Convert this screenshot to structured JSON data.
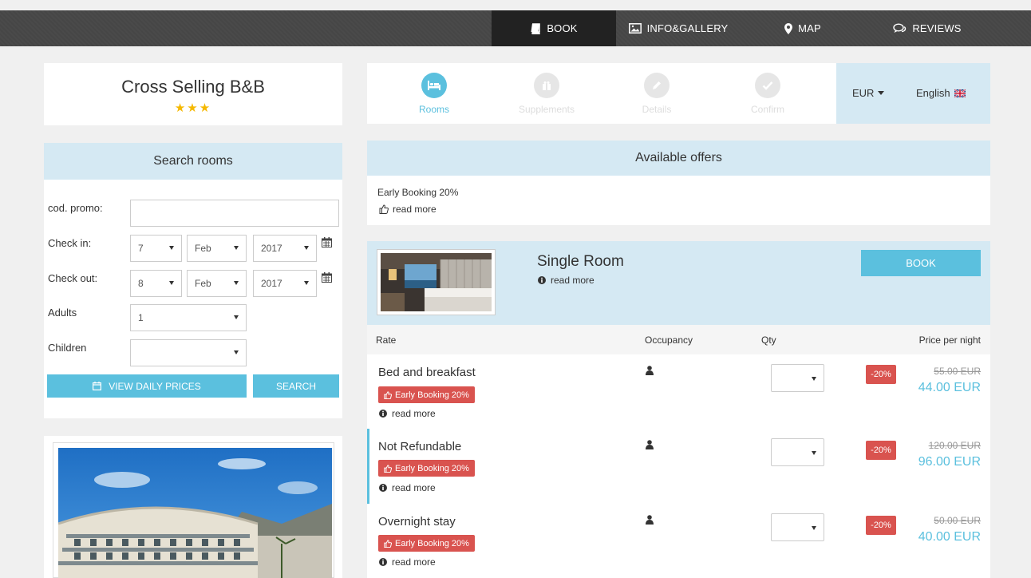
{
  "nav": {
    "book": "BOOK",
    "info": "INFO&GALLERY",
    "map": "MAP",
    "reviews": "REVIEWS"
  },
  "hotel": {
    "name": "Cross Selling B&B",
    "stars": "★★★"
  },
  "search": {
    "title": "Search rooms",
    "promo_label": "cod. promo:",
    "promo_value": "",
    "checkin_label": "Check in:",
    "checkin_day": "7",
    "checkin_month": "Feb",
    "checkin_year": "2017",
    "checkout_label": "Check out:",
    "checkout_day": "8",
    "checkout_month": "Feb",
    "checkout_year": "2017",
    "adults_label": "Adults",
    "adults_value": "1",
    "children_label": "Children",
    "children_value": "",
    "daily_prices_btn": "VIEW DAILY PRICES",
    "search_btn": "SEARCH"
  },
  "steps": [
    {
      "label": "Rooms"
    },
    {
      "label": "Supplements"
    },
    {
      "label": "Details"
    },
    {
      "label": "Confirm"
    }
  ],
  "currency": "EUR",
  "language": "English",
  "offers": {
    "title": "Available offers",
    "items": [
      {
        "name": "Early Booking 20%",
        "read_more": "read more"
      }
    ]
  },
  "room": {
    "name": "Single Room",
    "read_more": "read more",
    "book_btn": "BOOK",
    "columns": {
      "rate": "Rate",
      "occupancy": "Occupancy",
      "qty": "Qty",
      "price": "Price per night"
    },
    "rates": [
      {
        "name": "Bed and breakfast",
        "badge": "Early Booking 20%",
        "read_more": "read more",
        "qty": "",
        "discount": "-20%",
        "old_price": "55.00 EUR",
        "new_price": "44.00 EUR"
      },
      {
        "name": "Not Refundable",
        "badge": "Early Booking 20%",
        "read_more": "read more",
        "qty": "",
        "discount": "-20%",
        "old_price": "120.00 EUR",
        "new_price": "96.00 EUR"
      },
      {
        "name": "Overnight stay",
        "badge": "Early Booking 20%",
        "read_more": "read more",
        "qty": "",
        "discount": "-20%",
        "old_price": "50.00 EUR",
        "new_price": "40.00 EUR"
      }
    ]
  },
  "colors": {
    "accent": "#5bc0de",
    "header_bg": "#d5e9f3",
    "badge_red": "#d9534f",
    "nav_active": "#222222"
  }
}
